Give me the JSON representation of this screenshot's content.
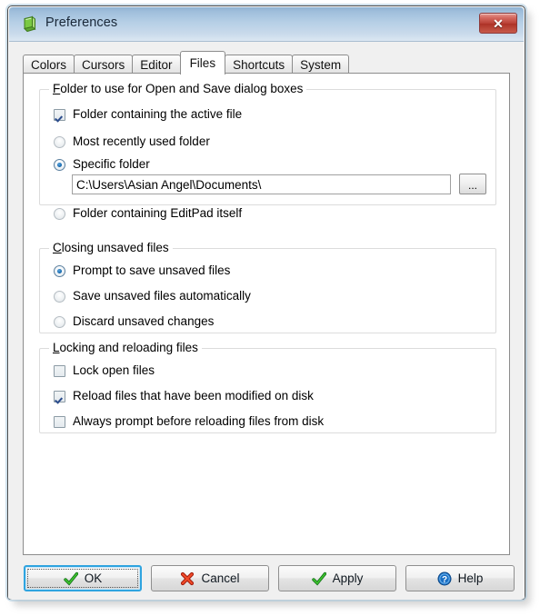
{
  "window": {
    "title": "Preferences",
    "app_icon": "editpad-notepad-icon",
    "close_label": "✕"
  },
  "tabs": [
    {
      "label": "Colors",
      "name": "tab-colors",
      "active": false
    },
    {
      "label": "Cursors",
      "name": "tab-cursors",
      "active": false
    },
    {
      "label": "Editor",
      "name": "tab-editor",
      "active": false
    },
    {
      "label": "Files",
      "name": "tab-files",
      "active": true
    },
    {
      "label": "Shortcuts",
      "name": "tab-shortcuts",
      "active": false
    },
    {
      "label": "System",
      "name": "tab-system",
      "active": false
    }
  ],
  "groups": {
    "folder": {
      "label_accel": "F",
      "label_rest": "older to use for Open and Save dialog boxes",
      "label_full": "Folder to use for Open and Save dialog boxes",
      "options": {
        "active_file_label": "Folder containing the active file",
        "active_file_checked": true,
        "mru_label": "Most recently used folder",
        "mru_checked": false,
        "specific_label": "Specific folder",
        "specific_checked": true,
        "editpad_label": "Folder containing EditPad itself",
        "editpad_checked": false
      },
      "path_value": "C:\\Users\\Asian Angel\\Documents\\",
      "path_placeholder": "",
      "browse_label": "..."
    },
    "closing": {
      "label_accel": "C",
      "label_rest": "losing unsaved files",
      "label_full": "Closing unsaved files",
      "options": [
        {
          "label": "Prompt to save unsaved files",
          "checked": true
        },
        {
          "label": "Save unsaved files automatically",
          "checked": false
        },
        {
          "label": "Discard unsaved changes",
          "checked": false
        }
      ]
    },
    "locking": {
      "label_accel": "L",
      "label_rest": "ocking and reloading files",
      "label_full": "Locking and reloading files",
      "options": [
        {
          "label": "Lock open files",
          "checked": false
        },
        {
          "label": "Reload files that have been modified on disk",
          "checked": true
        },
        {
          "label": "Always prompt before reloading files from disk",
          "checked": false
        }
      ]
    }
  },
  "footer": {
    "ok": {
      "label": "OK",
      "icon": "green-check-icon",
      "focused": true
    },
    "cancel": {
      "label": "Cancel",
      "icon": "red-x-icon",
      "focused": false
    },
    "apply": {
      "label": "Apply",
      "icon": "green-check-icon",
      "focused": false
    },
    "help": {
      "label": "Help",
      "icon": "blue-question-icon",
      "focused": false
    }
  },
  "colors": {
    "titlebar_top": "#8eb2d2",
    "titlebar_bottom": "#dbe7f2",
    "close_red": "#b93f34",
    "focus_blue": "#2fa4e0",
    "check_green": "#2e9b25",
    "cancel_red": "#d93b22",
    "help_blue": "#1a6fc4",
    "radio_dot_blue": "#1b6fb5",
    "checkmark_blue": "#2b4c8c",
    "dialog_bg": "#f0f0f0",
    "page_bg": "#ffffff",
    "group_border": "#dcdcdc"
  }
}
